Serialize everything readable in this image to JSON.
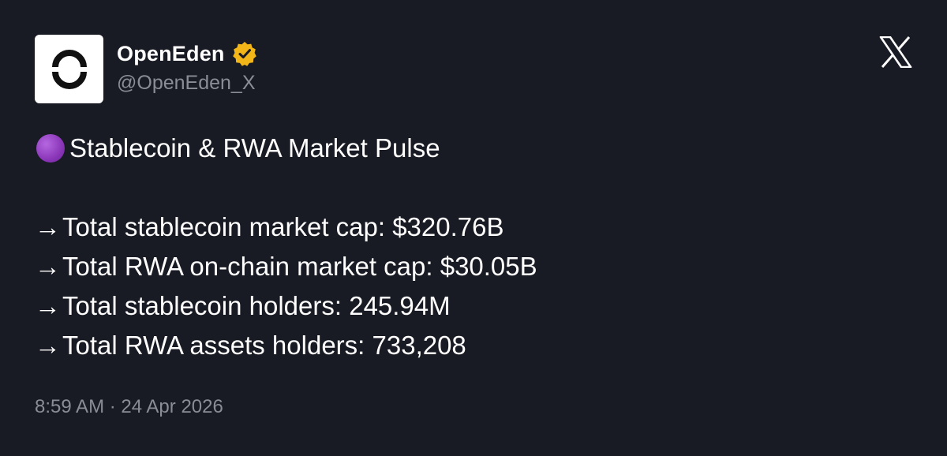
{
  "post": {
    "author": {
      "display_name": "OpenEden",
      "handle": "@OpenEden_X",
      "verified": true,
      "avatar_icon": "openeden-logo-icon",
      "verified_badge_color": "#f2b619"
    },
    "platform_icon": "x-logo-icon",
    "headline_emoji": "purple-circle-icon",
    "headline": "Stablecoin & RWA Market Pulse",
    "stats": [
      {
        "arrow": "→",
        "text": "Total stablecoin market cap: $320.76B"
      },
      {
        "arrow": "→",
        "text": "Total RWA on-chain market cap: $30.05B"
      },
      {
        "arrow": "→",
        "text": "Total stablecoin holders: 245.94M"
      },
      {
        "arrow": "→",
        "text": "Total RWA assets holders: 733,208"
      }
    ],
    "timestamp": "8:59 AM · 24 Apr 2026"
  },
  "colors": {
    "background": "#181a24",
    "text": "#ffffff",
    "muted": "#8b8d96",
    "accent_purple": "#8a36b8"
  }
}
